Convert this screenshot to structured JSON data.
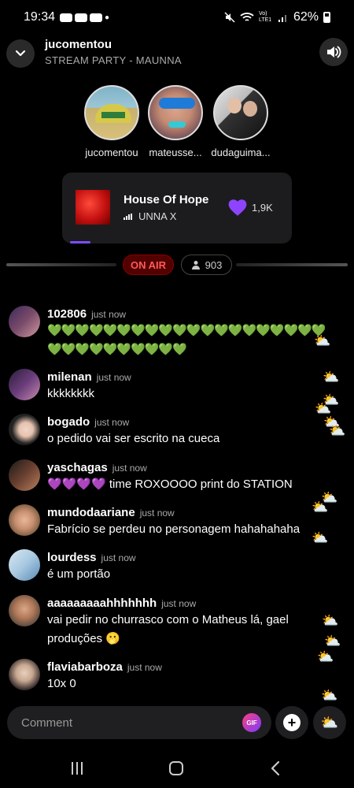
{
  "status": {
    "time": "19:34",
    "battery": "62%",
    "network": "Vo) LTE1"
  },
  "header": {
    "title": "jucomentou",
    "subtitle": "STREAM PARTY - MAUNNA"
  },
  "listeners": [
    {
      "name": "jucomentou"
    },
    {
      "name": "mateusse..."
    },
    {
      "name": "dudaguima..."
    }
  ],
  "track": {
    "title": "House Of Hope",
    "artist": "UNNA X",
    "likes": "1,9K"
  },
  "live": {
    "label": "ON AIR",
    "viewers": "903"
  },
  "comments": [
    {
      "user": "102806",
      "time": "just now",
      "text": "💚💚💚💚💚💚💚💚💚💚💚💚💚💚💚💚💚💚💚💚💚💚💚💚💚💚💚💚💚💚"
    },
    {
      "user": "milenan",
      "time": "just now",
      "text": "kkkkkkkk"
    },
    {
      "user": "bogado",
      "time": "just now",
      "text": "o pedido vai ser escrito na cueca"
    },
    {
      "user": "yaschagas",
      "time": "just now",
      "text": "💜💜💜💜 time ROXOOOO print do STATION"
    },
    {
      "user": "mundodaariane",
      "time": "just now",
      "text": "Fabrício se perdeu no personagem hahahahaha"
    },
    {
      "user": "lourdess",
      "time": "just now",
      "text": " é um portão"
    },
    {
      "user": "aaaaaaaaahhhhhhh",
      "time": "just now",
      "text": "vai pedir no churrasco com o Matheus lá, gael produções 🫢"
    },
    {
      "user": "flaviabarboza",
      "time": "just now",
      "text": "10x 0"
    }
  ],
  "input": {
    "placeholder": "Comment",
    "gif_label": "GIF"
  },
  "icons": {
    "collapse": "chevron-down-icon",
    "sound": "speaker-icon",
    "like": "heart-icon",
    "reaction": "sun-behind-cloud-icon"
  },
  "colors": {
    "accent": "#7c4dff",
    "live": "#ff5a5a",
    "heart": "#8e44ff"
  }
}
